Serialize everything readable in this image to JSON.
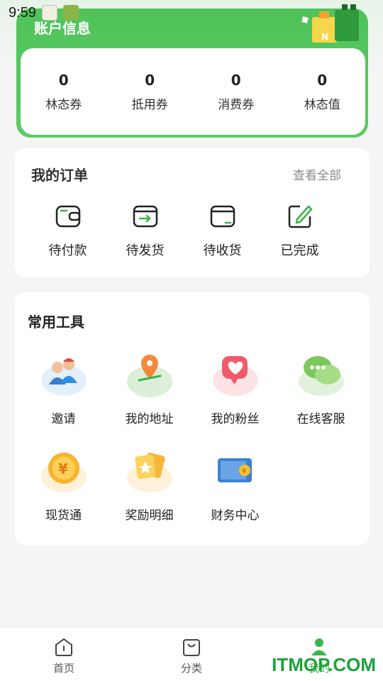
{
  "status_bar": {
    "time": "9:59"
  },
  "account": {
    "title": "账户信息",
    "stats": [
      {
        "value": "0",
        "label": "林态券"
      },
      {
        "value": "0",
        "label": "抵用券"
      },
      {
        "value": "0",
        "label": "消费券"
      },
      {
        "value": "0",
        "label": "林态值"
      }
    ]
  },
  "orders": {
    "title": "我的订单",
    "view_all": "查看全部",
    "items": [
      {
        "label": "待付款",
        "icon": "wallet-icon"
      },
      {
        "label": "待发货",
        "icon": "shipping-box-icon"
      },
      {
        "label": "待收货",
        "icon": "receive-box-icon"
      },
      {
        "label": "已完成",
        "icon": "edit-done-icon"
      }
    ]
  },
  "tools": {
    "title": "常用工具",
    "items": [
      {
        "label": "邀请",
        "icon": "invite-people-icon"
      },
      {
        "label": "我的地址",
        "icon": "location-pin-icon"
      },
      {
        "label": "我的粉丝",
        "icon": "heart-chat-icon"
      },
      {
        "label": "在线客服",
        "icon": "chat-bubbles-icon"
      },
      {
        "label": "现货通",
        "icon": "yuan-coin-icon"
      },
      {
        "label": "奖励明细",
        "icon": "reward-cards-icon"
      },
      {
        "label": "财务中心",
        "icon": "wallet-card-icon"
      }
    ]
  },
  "bottom_nav": {
    "items": [
      {
        "label": "首页",
        "icon": "home-icon",
        "active": false
      },
      {
        "label": "分类",
        "icon": "bag-icon",
        "active": false
      },
      {
        "label": "我的",
        "icon": "user-icon",
        "active": true
      }
    ]
  },
  "watermark": "ITMOP.COM",
  "colors": {
    "brand_green": "#4fc45a",
    "active_green": "#3ab54a",
    "watermark_green": "#1aa33a"
  }
}
